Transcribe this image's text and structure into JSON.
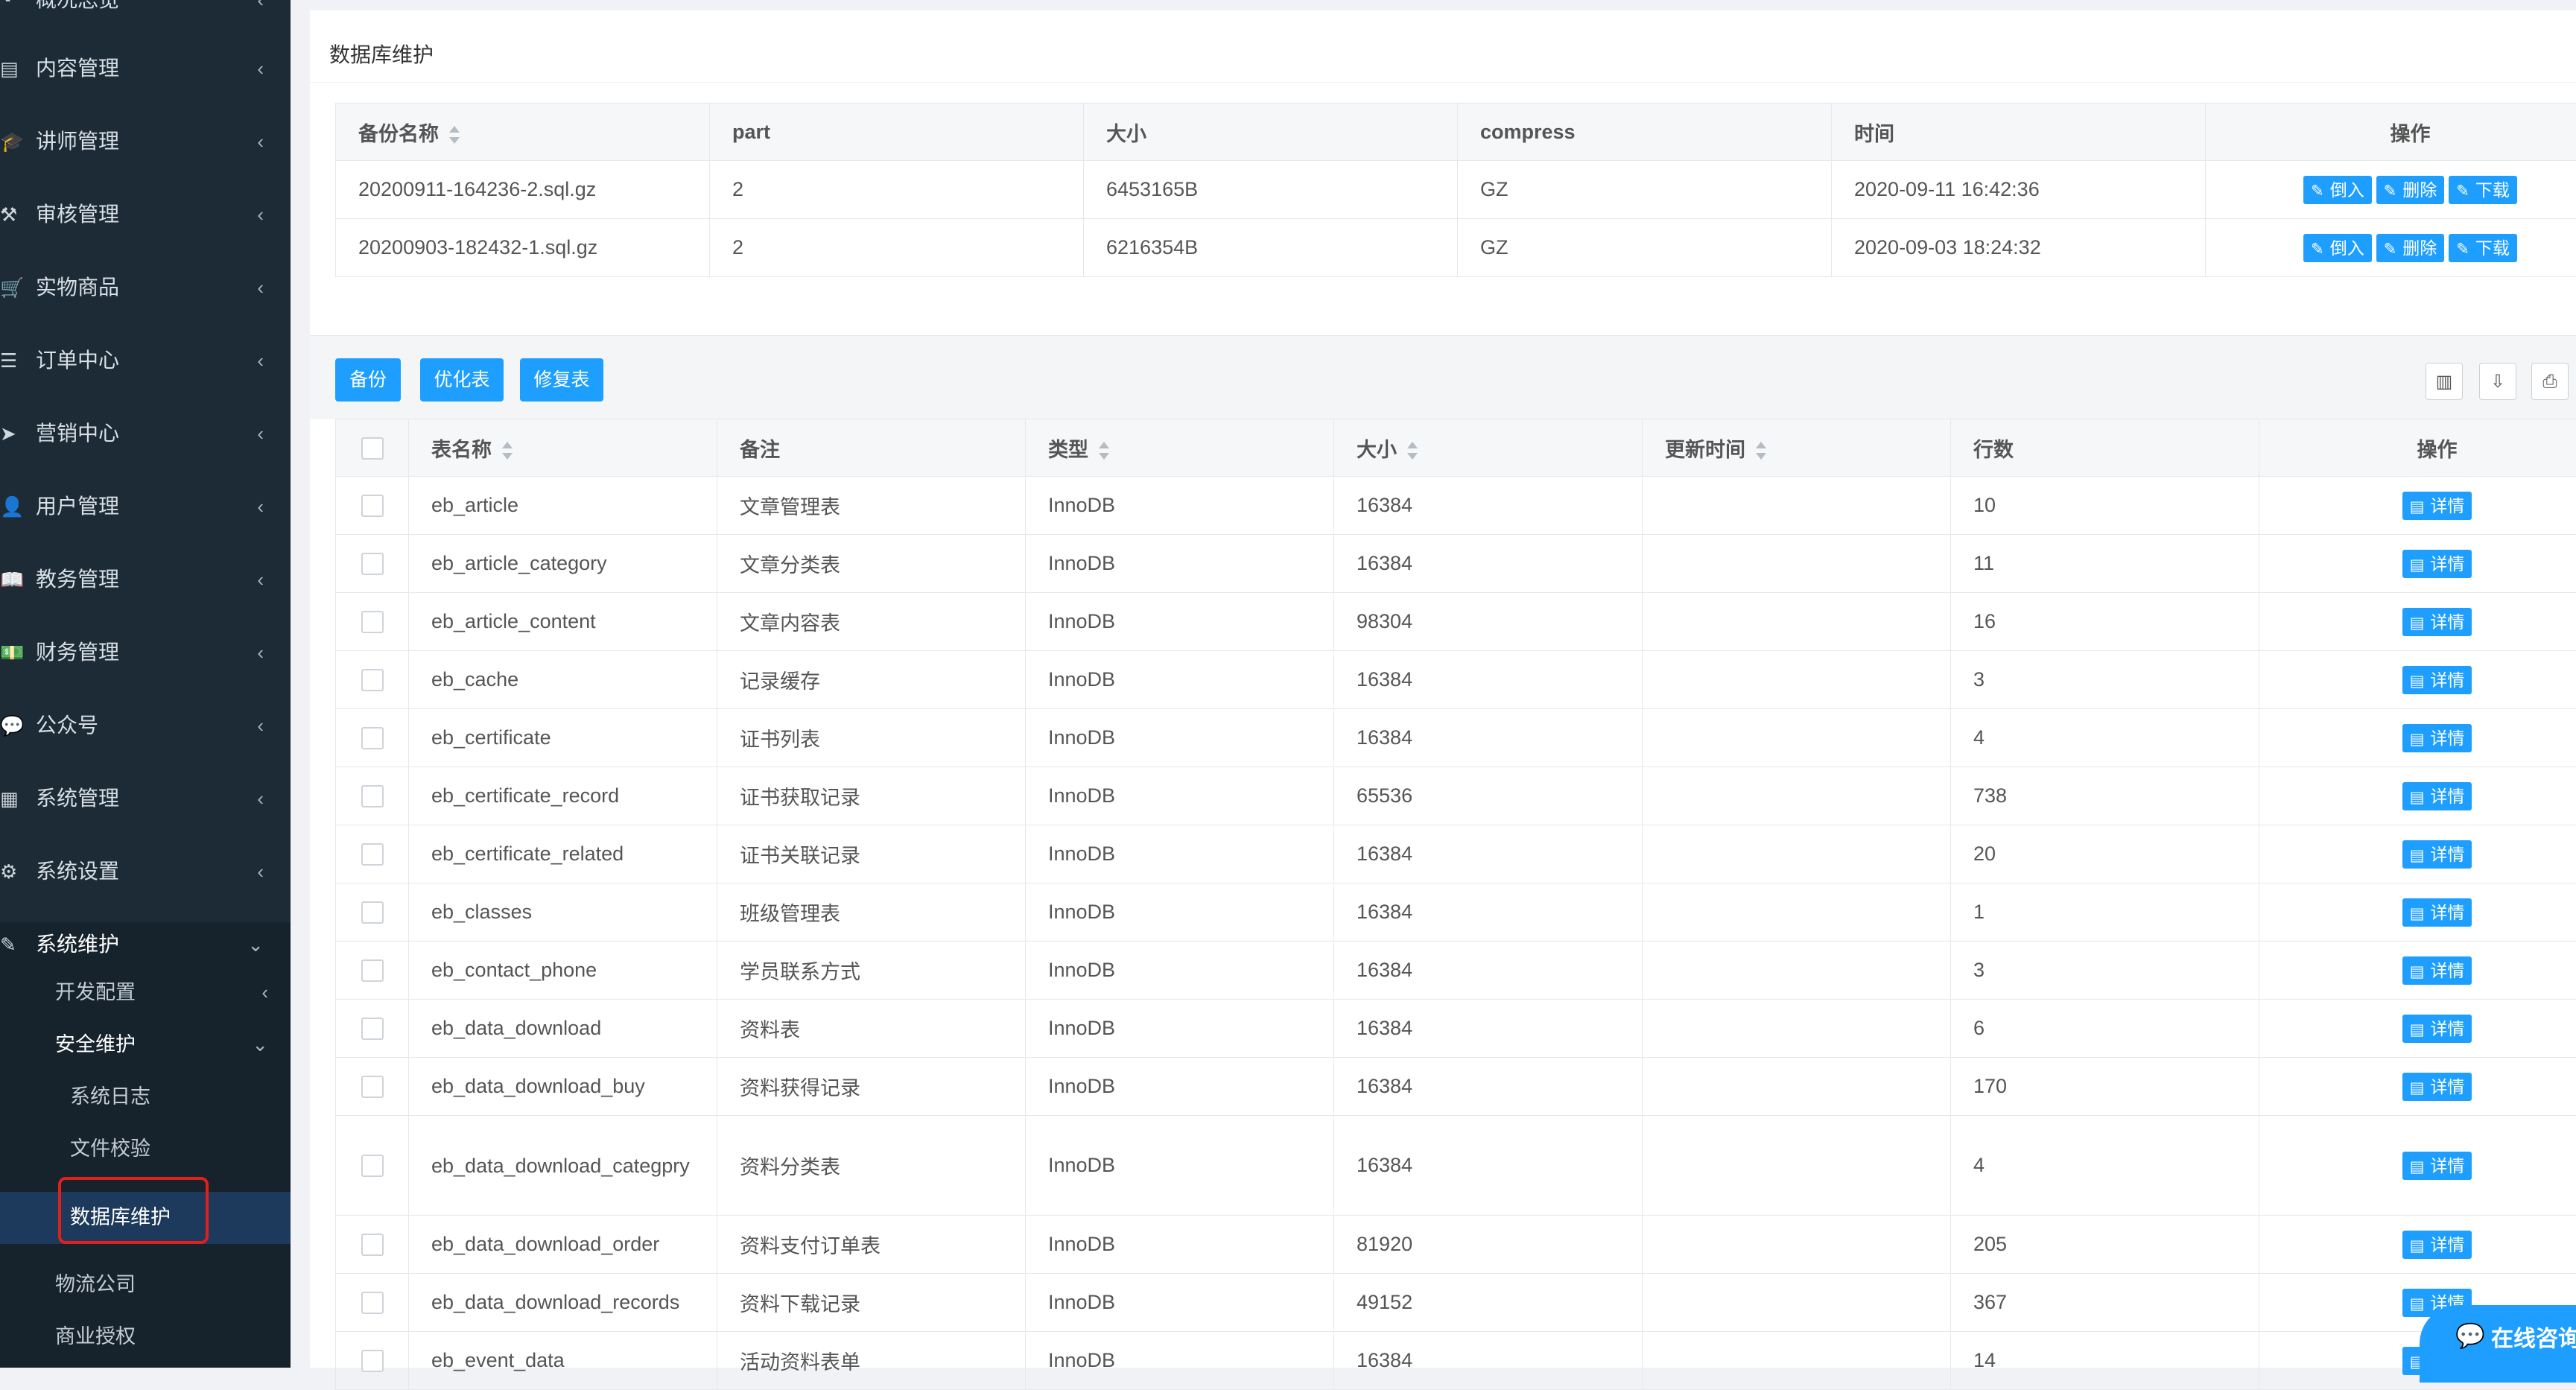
{
  "sidebar": {
    "menu": [
      {
        "name": "overview",
        "label": "概况总览",
        "icon": "gauge-icon",
        "glyph": "◔"
      },
      {
        "name": "content",
        "label": "内容管理",
        "icon": "newspaper-icon",
        "glyph": "▤"
      },
      {
        "name": "lecturer",
        "label": "讲师管理",
        "icon": "graduation-cap-icon",
        "glyph": "🎓"
      },
      {
        "name": "audit",
        "label": "审核管理",
        "icon": "gavel-icon",
        "glyph": "⚒"
      },
      {
        "name": "goods",
        "label": "实物商品",
        "icon": "cart-icon",
        "glyph": "🛒"
      },
      {
        "name": "orders",
        "label": "订单中心",
        "icon": "list-icon",
        "glyph": "☰"
      },
      {
        "name": "marketing",
        "label": "营销中心",
        "icon": "paper-plane-icon",
        "glyph": "➤"
      },
      {
        "name": "users",
        "label": "用户管理",
        "icon": "user-icon",
        "glyph": "👤"
      },
      {
        "name": "education",
        "label": "教务管理",
        "icon": "book-icon",
        "glyph": "📖"
      },
      {
        "name": "finance",
        "label": "财务管理",
        "icon": "money-icon",
        "glyph": "💵"
      },
      {
        "name": "wechat",
        "label": "公众号",
        "icon": "wechat-icon",
        "glyph": "💬"
      },
      {
        "name": "system",
        "label": "系统管理",
        "icon": "grid-icon",
        "glyph": "▦"
      },
      {
        "name": "settings",
        "label": "系统设置",
        "icon": "gear-icon",
        "glyph": "⚙"
      },
      {
        "name": "maintenance",
        "label": "系统维护",
        "icon": "wand-icon",
        "glyph": "✎"
      }
    ],
    "sub": {
      "dev_config": "开发配置",
      "security": "安全维护",
      "system_log": "系统日志",
      "file_check": "文件校验",
      "db_maintenance": "数据库维护",
      "logistics": "物流公司",
      "license": "商业授权"
    }
  },
  "page": {
    "title": "数据库维护"
  },
  "backup_table": {
    "headers": {
      "name": "备份名称",
      "part": "part",
      "size": "大小",
      "compress": "compress",
      "time": "时间",
      "ops": "操作"
    },
    "rows": [
      {
        "name": "20200911-164236-2.sql.gz",
        "part": "2",
        "size": "6453165B",
        "compress": "GZ",
        "time": "2020-09-11 16:42:36"
      },
      {
        "name": "20200903-182432-1.sql.gz",
        "part": "2",
        "size": "6216354B",
        "compress": "GZ",
        "time": "2020-09-03 18:24:32"
      }
    ],
    "actions": {
      "import": "倒入",
      "delete": "删除",
      "download": "下载"
    }
  },
  "toolbar": {
    "backup": "备份",
    "optimize": "优化表",
    "repair": "修复表",
    "icons": [
      "columns-icon",
      "export-icon",
      "print-icon"
    ]
  },
  "tables_table": {
    "headers": {
      "name": "表名称",
      "comment": "备注",
      "type": "类型",
      "size": "大小",
      "updated": "更新时间",
      "rows": "行数",
      "ops": "操作"
    },
    "detail_label": "详情",
    "rows": [
      {
        "name": "eb_article",
        "comment": "文章管理表",
        "type": "InnoDB",
        "size": "16384",
        "updated": "",
        "rows": "10"
      },
      {
        "name": "eb_article_category",
        "comment": "文章分类表",
        "type": "InnoDB",
        "size": "16384",
        "updated": "",
        "rows": "11"
      },
      {
        "name": "eb_article_content",
        "comment": "文章内容表",
        "type": "InnoDB",
        "size": "98304",
        "updated": "",
        "rows": "16"
      },
      {
        "name": "eb_cache",
        "comment": "记录缓存",
        "type": "InnoDB",
        "size": "16384",
        "updated": "",
        "rows": "3"
      },
      {
        "name": "eb_certificate",
        "comment": "证书列表",
        "type": "InnoDB",
        "size": "16384",
        "updated": "",
        "rows": "4"
      },
      {
        "name": "eb_certificate_record",
        "comment": "证书获取记录",
        "type": "InnoDB",
        "size": "65536",
        "updated": "",
        "rows": "738"
      },
      {
        "name": "eb_certificate_related",
        "comment": "证书关联记录",
        "type": "InnoDB",
        "size": "16384",
        "updated": "",
        "rows": "20"
      },
      {
        "name": "eb_classes",
        "comment": "班级管理表",
        "type": "InnoDB",
        "size": "16384",
        "updated": "",
        "rows": "1"
      },
      {
        "name": "eb_contact_phone",
        "comment": "学员联系方式",
        "type": "InnoDB",
        "size": "16384",
        "updated": "",
        "rows": "3"
      },
      {
        "name": "eb_data_download",
        "comment": "资料表",
        "type": "InnoDB",
        "size": "16384",
        "updated": "",
        "rows": "6"
      },
      {
        "name": "eb_data_download_buy",
        "comment": "资料获得记录",
        "type": "InnoDB",
        "size": "16384",
        "updated": "",
        "rows": "170"
      },
      {
        "name": "eb_data_download_categpry",
        "comment": "资料分类表",
        "type": "InnoDB",
        "size": "16384",
        "updated": "",
        "rows": "4"
      },
      {
        "name": "eb_data_download_order",
        "comment": "资料支付订单表",
        "type": "InnoDB",
        "size": "81920",
        "updated": "",
        "rows": "205"
      },
      {
        "name": "eb_data_download_records",
        "comment": "资料下载记录",
        "type": "InnoDB",
        "size": "49152",
        "updated": "",
        "rows": "367"
      },
      {
        "name": "eb_event_data",
        "comment": "活动资料表单",
        "type": "InnoDB",
        "size": "16384",
        "updated": "",
        "rows": "14"
      }
    ]
  },
  "chat_widget": {
    "label": "在线咨询",
    "icon": "chat-bubble-icon"
  },
  "colors": {
    "sidebar_bg": "#1c2b36",
    "primary": "#1e9fff",
    "highlight_border": "#e0201c",
    "active_item": "#1d3a5c"
  }
}
